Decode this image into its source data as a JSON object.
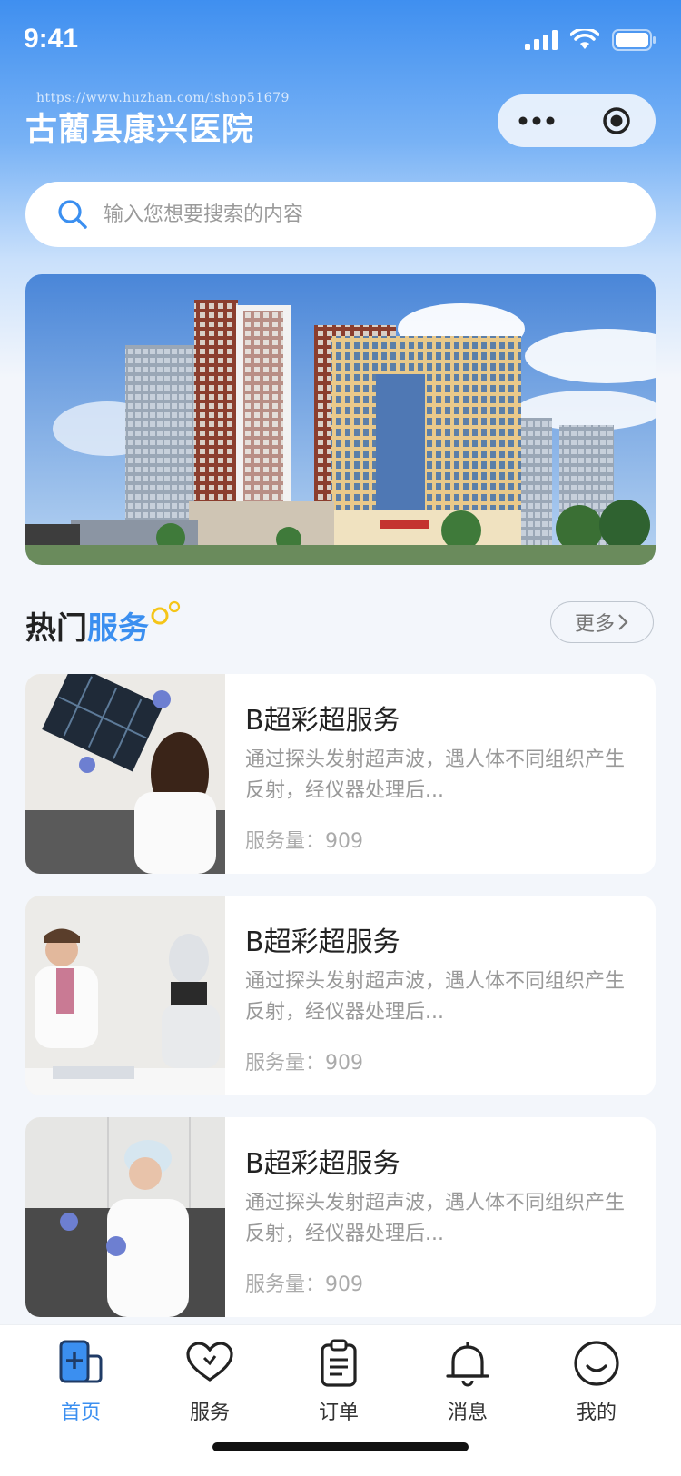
{
  "status_bar": {
    "time": "9:41"
  },
  "watermark": "https://www.huzhan.com/ishop51679",
  "header": {
    "title": "古藺县康兴医院"
  },
  "search": {
    "placeholder": "输入您想要搜索的内容"
  },
  "section": {
    "title_black": "热门",
    "title_blue": "服务",
    "more_label": "更多"
  },
  "services": [
    {
      "title": "B超彩超服务",
      "desc": "通过探头发射超声波，遇人体不同组织产生反射，经仪器处理后...",
      "count_label": "服务量：",
      "count": "909"
    },
    {
      "title": "B超彩超服务",
      "desc": "通过探头发射超声波，遇人体不同组织产生反射，经仪器处理后...",
      "count_label": "服务量：",
      "count": "909"
    },
    {
      "title": "B超彩超服务",
      "desc": "通过探头发射超声波，遇人体不同组织产生反射，经仪器处理后...",
      "count_label": "服务量：",
      "count": "909"
    }
  ],
  "tabbar": [
    {
      "label": "首页",
      "icon": "home-icon",
      "active": true
    },
    {
      "label": "服务",
      "icon": "heart-icon",
      "active": false
    },
    {
      "label": "订单",
      "icon": "clipboard-icon",
      "active": false
    },
    {
      "label": "消息",
      "icon": "bell-icon",
      "active": false
    },
    {
      "label": "我的",
      "icon": "smile-icon",
      "active": false
    }
  ],
  "colors": {
    "accent": "#3b8ff0",
    "header_gradient_top": "#3f8ff0"
  }
}
